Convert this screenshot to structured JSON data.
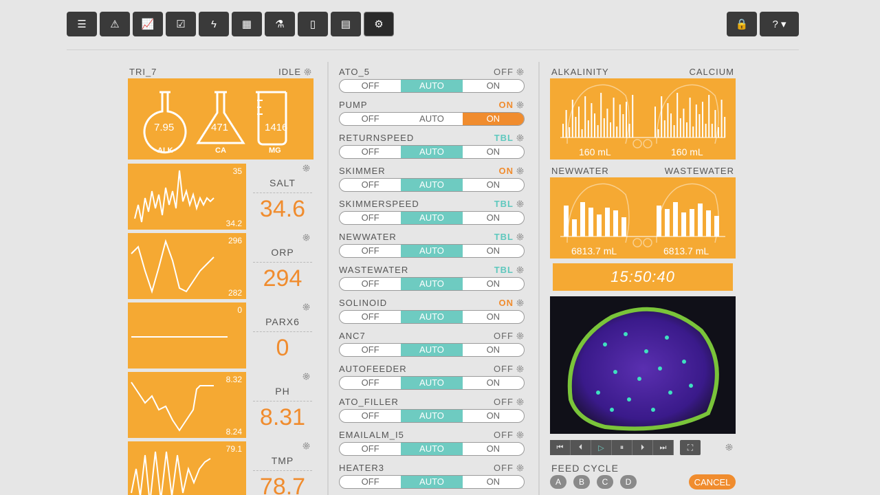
{
  "toolbar": {
    "buttons": [
      {
        "icon": "list-icon",
        "glyph": "☰"
      },
      {
        "icon": "warning-icon",
        "glyph": "⚠"
      },
      {
        "icon": "chart-icon",
        "glyph": "📈"
      },
      {
        "icon": "checklist-icon",
        "glyph": "☑"
      },
      {
        "icon": "lightning-icon",
        "glyph": "ϟ"
      },
      {
        "icon": "calendar-icon",
        "glyph": "▦"
      },
      {
        "icon": "flask-icon",
        "glyph": "⚗"
      },
      {
        "icon": "file-icon",
        "glyph": "▯"
      },
      {
        "icon": "clipboard-icon",
        "glyph": "▤"
      },
      {
        "icon": "gears-icon",
        "glyph": "⚙"
      }
    ],
    "lock_glyph": "🔒",
    "help_glyph": "? ▾"
  },
  "trident": {
    "name": "TRI_7",
    "status": "IDLE",
    "alk_value": "7.95",
    "alk_label": "ALK",
    "ca_value": "471",
    "ca_label": "CA",
    "mg_value": "1416",
    "mg_label": "MG"
  },
  "sensors": [
    {
      "name": "SALT",
      "reading": "34.6",
      "max": "35",
      "min": "34.2"
    },
    {
      "name": "ORP",
      "reading": "294",
      "max": "296",
      "min": "282"
    },
    {
      "name": "PARX6",
      "reading": "0",
      "max": "0",
      "min": ""
    },
    {
      "name": "PH",
      "reading": "8.31",
      "max": "8.32",
      "min": "8.24"
    },
    {
      "name": "TMP",
      "reading": "78.7",
      "max": "79.1",
      "min": ""
    }
  ],
  "outlets": [
    {
      "name": "ATO_5",
      "state": "OFF",
      "sel": "auto"
    },
    {
      "name": "PUMP",
      "state": "ON",
      "sel": "on"
    },
    {
      "name": "RETURNSPEED",
      "state": "TBL",
      "sel": "auto"
    },
    {
      "name": "SKIMMER",
      "state": "ON",
      "sel": "auto"
    },
    {
      "name": "SKIMMERSPEED",
      "state": "TBL",
      "sel": "auto"
    },
    {
      "name": "NEWWATER",
      "state": "TBL",
      "sel": "auto"
    },
    {
      "name": "WASTEWATER",
      "state": "TBL",
      "sel": "auto"
    },
    {
      "name": "SOLINOID",
      "state": "ON",
      "sel": "auto"
    },
    {
      "name": "ANC7",
      "state": "OFF",
      "sel": "auto"
    },
    {
      "name": "AUTOFEEDER",
      "state": "OFF",
      "sel": "auto"
    },
    {
      "name": "ATO_FILLER",
      "state": "OFF",
      "sel": "auto"
    },
    {
      "name": "EMAILALM_I5",
      "state": "OFF",
      "sel": "auto"
    },
    {
      "name": "HEATER3",
      "state": "OFF",
      "sel": "auto"
    }
  ],
  "seg_labels": {
    "off": "OFF",
    "auto": "AUTO",
    "on": "ON"
  },
  "dosing": {
    "alk_title": "ALKALINITY",
    "ca_title": "CALCIUM",
    "alk_ml": "160 mL",
    "ca_ml": "160 mL",
    "new_title": "NEWWATER",
    "waste_title": "WASTEWATER",
    "new_ml": "6813.7 mL",
    "waste_ml": "6813.7 mL"
  },
  "clock": "15:50:40",
  "video": {
    "glyphs": [
      "⏮",
      "⏴",
      "▷",
      "⏸",
      "⏵",
      "⏭"
    ],
    "fullscreen_glyph": "⛶"
  },
  "feed": {
    "title": "FEED CYCLE",
    "buttons": [
      "A",
      "B",
      "C",
      "D"
    ],
    "cancel": "CANCEL"
  }
}
